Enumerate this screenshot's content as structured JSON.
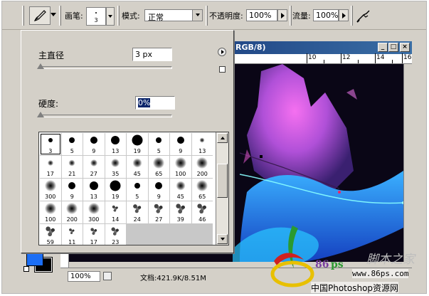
{
  "options_bar": {
    "brush_label": "画笔:",
    "brush_size": "3",
    "mode_label": "模式:",
    "mode_value": "正常",
    "opacity_label": "不透明度:",
    "opacity_value": "100%",
    "flow_label": "流量:",
    "flow_value": "100%"
  },
  "brush_panel": {
    "diameter_label": "主直径",
    "diameter_value": "3 px",
    "hardness_label": "硬度:",
    "hardness_value": "0%",
    "presets": [
      {
        "size": "3",
        "style": "hard"
      },
      {
        "size": "5",
        "style": "hard"
      },
      {
        "size": "9",
        "style": "hard"
      },
      {
        "size": "13",
        "style": "hard"
      },
      {
        "size": "19",
        "style": "hard"
      },
      {
        "size": "5",
        "style": "hard"
      },
      {
        "size": "9",
        "style": "hard"
      },
      {
        "size": "13",
        "style": "soft"
      },
      {
        "size": "17",
        "style": "soft"
      },
      {
        "size": "21",
        "style": "soft"
      },
      {
        "size": "27",
        "style": "soft"
      },
      {
        "size": "35",
        "style": "soft"
      },
      {
        "size": "45",
        "style": "soft"
      },
      {
        "size": "65",
        "style": "soft"
      },
      {
        "size": "100",
        "style": "soft"
      },
      {
        "size": "200",
        "style": "soft"
      },
      {
        "size": "300",
        "style": "soft"
      },
      {
        "size": "9",
        "style": "hard"
      },
      {
        "size": "13",
        "style": "hard"
      },
      {
        "size": "19",
        "style": "hard"
      },
      {
        "size": "5",
        "style": "hard"
      },
      {
        "size": "9",
        "style": "hard"
      },
      {
        "size": "45",
        "style": "soft"
      },
      {
        "size": "65",
        "style": "soft"
      },
      {
        "size": "100",
        "style": "soft"
      },
      {
        "size": "200",
        "style": "soft"
      },
      {
        "size": "300",
        "style": "soft"
      },
      {
        "size": "14",
        "style": "scatter"
      },
      {
        "size": "24",
        "style": "scatter"
      },
      {
        "size": "27",
        "style": "scatter"
      },
      {
        "size": "39",
        "style": "scatter"
      },
      {
        "size": "46",
        "style": "scatter"
      },
      {
        "size": "59",
        "style": "scatter"
      },
      {
        "size": "11",
        "style": "scatter"
      },
      {
        "size": "17",
        "style": "scatter"
      },
      {
        "size": "23",
        "style": "scatter"
      }
    ]
  },
  "document": {
    "title_fragment": "RGB/8)",
    "ruler_numbers": [
      "10",
      "12",
      "14",
      "16"
    ],
    "zoom": "100%",
    "doc_info": "文档:421.9K/8.51M"
  },
  "colors": {
    "foreground": "#1b6ef5",
    "background": "#000000",
    "title_bar": "#0a246a"
  },
  "watermark": {
    "brand_num": "86",
    "brand_ps": "ps",
    "site_cn": "脚本之家",
    "url": "www.86ps.com",
    "name": "中国Photoshop资源网"
  }
}
